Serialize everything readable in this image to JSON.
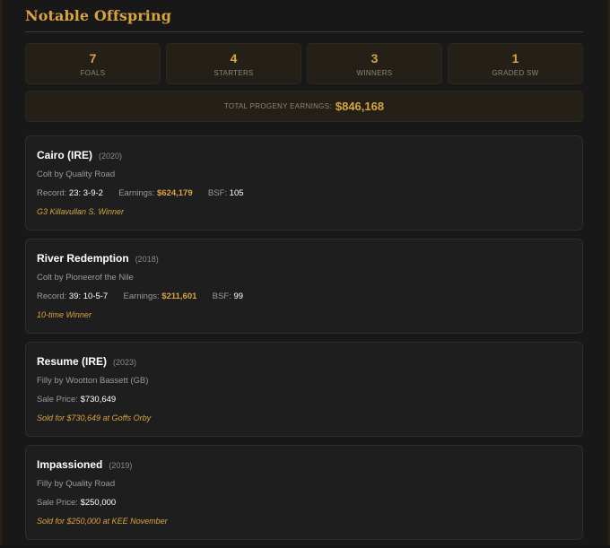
{
  "header": {
    "title": "Notable Offspring"
  },
  "stats": [
    {
      "value": "7",
      "label": "FOALS"
    },
    {
      "value": "4",
      "label": "STARTERS"
    },
    {
      "value": "3",
      "label": "WINNERS"
    },
    {
      "value": "1",
      "label": "GRADED SW"
    }
  ],
  "total": {
    "label": "TOTAL PROGENY EARNINGS:",
    "value": "$846,168"
  },
  "offspring": [
    {
      "name": "Cairo (IRE)",
      "year": "(2020)",
      "breeding": "Colt by Quality Road",
      "record_label": "Record:",
      "record": "23: 3-9-2",
      "earnings_label": "Earnings:",
      "earnings": "$624,179",
      "bsf_label": "BSF:",
      "bsf": "105",
      "note": "G3 Killavullan S. Winner"
    },
    {
      "name": "River Redemption",
      "year": "(2018)",
      "breeding": "Colt by Pioneerof the Nile",
      "record_label": "Record:",
      "record": "39: 10-5-7",
      "earnings_label": "Earnings:",
      "earnings": "$211,601",
      "bsf_label": "BSF:",
      "bsf": "99",
      "note": "10-time Winner"
    },
    {
      "name": "Resume (IRE)",
      "year": "(2023)",
      "breeding": "Filly by Wootton Bassett (GB)",
      "sale_label": "Sale Price:",
      "sale": "$730,649",
      "note": "Sold for $730,649 at Goffs Orby"
    },
    {
      "name": "Impassioned",
      "year": "(2019)",
      "breeding": "Filly by Quality Road",
      "sale_label": "Sale Price:",
      "sale": "$250,000",
      "note": "Sold for $250,000 at KEE November"
    }
  ],
  "colors": {
    "accent": "#d9a440",
    "background": "#181818",
    "card": "#1e1e1e"
  }
}
